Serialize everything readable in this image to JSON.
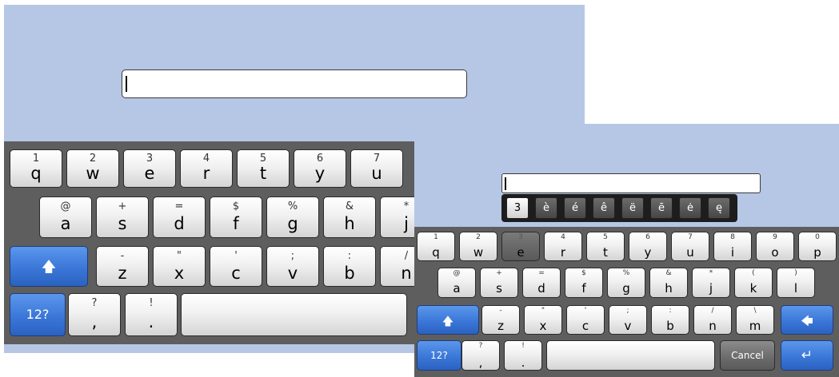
{
  "large_keyboard": {
    "input_value": "",
    "row1": [
      {
        "alt": "1",
        "main": "q"
      },
      {
        "alt": "2",
        "main": "w"
      },
      {
        "alt": "3",
        "main": "e"
      },
      {
        "alt": "4",
        "main": "r"
      },
      {
        "alt": "5",
        "main": "t"
      },
      {
        "alt": "6",
        "main": "y"
      },
      {
        "alt": "7",
        "main": "u"
      }
    ],
    "row2": [
      {
        "alt": "@",
        "main": "a"
      },
      {
        "alt": "+",
        "main": "s"
      },
      {
        "alt": "=",
        "main": "d"
      },
      {
        "alt": "$",
        "main": "f"
      },
      {
        "alt": "%",
        "main": "g"
      },
      {
        "alt": "&",
        "main": "h"
      },
      {
        "alt": "*",
        "main": "j"
      }
    ],
    "row3": [
      {
        "alt": "-",
        "main": "z"
      },
      {
        "alt": "\"",
        "main": "x"
      },
      {
        "alt": "'",
        "main": "c"
      },
      {
        "alt": ";",
        "main": "v"
      },
      {
        "alt": ":",
        "main": "b"
      },
      {
        "alt": "/",
        "main": "n"
      }
    ],
    "shift_icon": "shift-arrow-icon",
    "num_toggle_label": "12?",
    "row4": [
      {
        "alt": "?",
        "main": ","
      },
      {
        "alt": "!",
        "main": "."
      }
    ]
  },
  "small_keyboard": {
    "input_value": "",
    "accent_popup": [
      "3",
      "è",
      "é",
      "ê",
      "ë",
      "ē",
      "ė",
      "ę"
    ],
    "row1": [
      {
        "alt": "1",
        "main": "q"
      },
      {
        "alt": "2",
        "main": "w"
      },
      {
        "alt": "3",
        "main": "e"
      },
      {
        "alt": "4",
        "main": "r"
      },
      {
        "alt": "5",
        "main": "t"
      },
      {
        "alt": "6",
        "main": "y"
      },
      {
        "alt": "7",
        "main": "u"
      },
      {
        "alt": "8",
        "main": "i"
      },
      {
        "alt": "9",
        "main": "o"
      },
      {
        "alt": "0",
        "main": "p"
      }
    ],
    "row2": [
      {
        "alt": "@",
        "main": "a"
      },
      {
        "alt": "+",
        "main": "s"
      },
      {
        "alt": "=",
        "main": "d"
      },
      {
        "alt": "$",
        "main": "f"
      },
      {
        "alt": "%",
        "main": "g"
      },
      {
        "alt": "&",
        "main": "h"
      },
      {
        "alt": "*",
        "main": "j"
      },
      {
        "alt": "(",
        "main": "k"
      },
      {
        "alt": ")",
        "main": "l"
      }
    ],
    "row3": [
      {
        "alt": "-",
        "main": "z"
      },
      {
        "alt": "\"",
        "main": "x"
      },
      {
        "alt": "'",
        "main": "c"
      },
      {
        "alt": ";",
        "main": "v"
      },
      {
        "alt": ":",
        "main": "b"
      },
      {
        "alt": "/",
        "main": "n"
      },
      {
        "alt": "\\",
        "main": "m"
      }
    ],
    "shift_icon": "shift-arrow-icon",
    "backspace_icon": "backspace-arrow-icon",
    "num_toggle_label": "12?",
    "row4": [
      {
        "alt": "?",
        "main": ","
      },
      {
        "alt": "!",
        "main": "."
      }
    ],
    "cancel_label": "Cancel",
    "enter_icon": "enter-return-icon"
  },
  "colors": {
    "background": "#b5c7e5",
    "keyboard_bg": "#5e5e5e",
    "accent_blue": "#3b77d8"
  }
}
